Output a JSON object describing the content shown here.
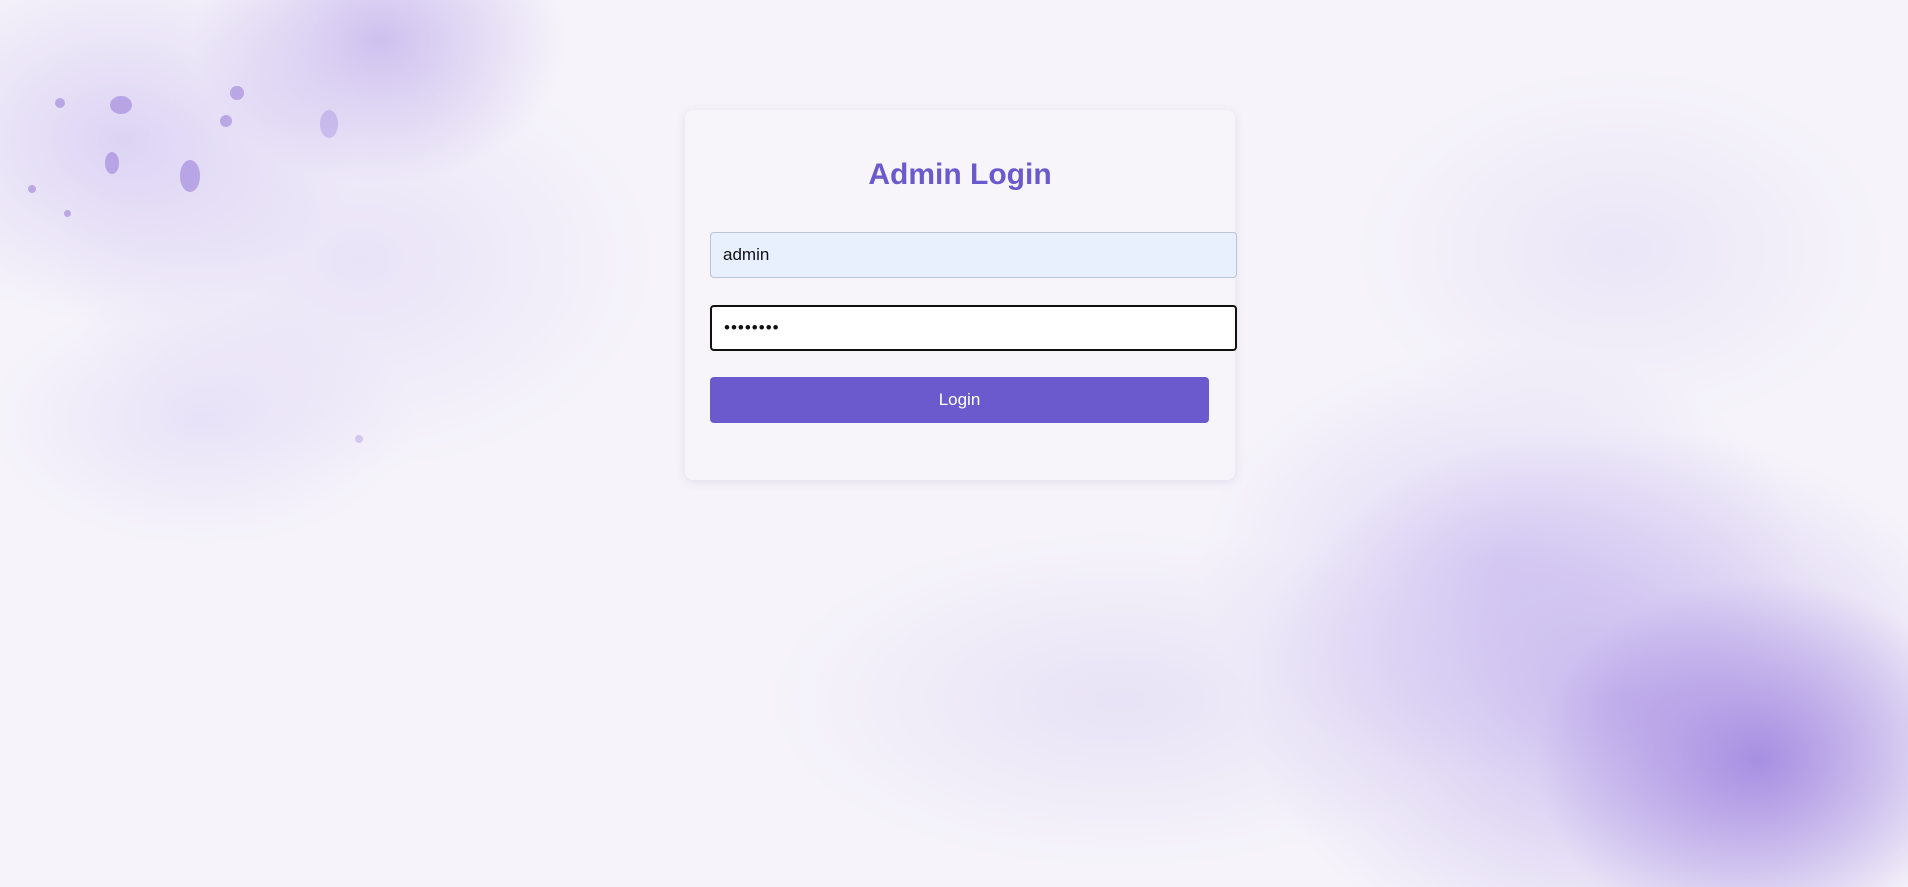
{
  "login": {
    "title": "Admin Login",
    "username_value": "admin",
    "password_value": "••••••••",
    "button_label": "Login"
  },
  "colors": {
    "accent": "#6a5acd",
    "background": "#f6f4fa",
    "autofill": "#e8f0fe"
  }
}
